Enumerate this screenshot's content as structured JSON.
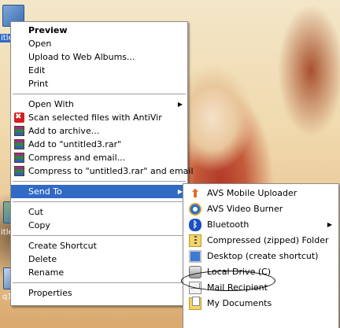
{
  "desktop": {
    "icons": [
      {
        "label": "itle"
      },
      {
        "label": "itle"
      },
      {
        "label": "q1"
      }
    ]
  },
  "context_menu": {
    "items": [
      {
        "label": "Preview",
        "bold": true
      },
      {
        "label": "Open"
      },
      {
        "label": "Upload to Web Albums..."
      },
      {
        "label": "Edit"
      },
      {
        "label": "Print"
      },
      {
        "label": "Open With",
        "submenu": true
      },
      {
        "label": "Scan selected files with AntiVir",
        "icon": "antivir-icon"
      },
      {
        "label": "Add to archive...",
        "icon": "winrar-icon"
      },
      {
        "label": "Add to \"untitled3.rar\"",
        "icon": "winrar-icon"
      },
      {
        "label": "Compress and email...",
        "icon": "winrar-icon"
      },
      {
        "label": "Compress to \"untitled3.rar\" and email",
        "icon": "winrar-icon"
      },
      {
        "label": "Send To",
        "submenu": true,
        "selected": true
      },
      {
        "label": "Cut"
      },
      {
        "label": "Copy"
      },
      {
        "label": "Create Shortcut"
      },
      {
        "label": "Delete"
      },
      {
        "label": "Rename"
      },
      {
        "label": "Properties"
      }
    ]
  },
  "send_to_menu": {
    "items": [
      {
        "label": "AVS Mobile Uploader",
        "icon": "upload-arrow-icon"
      },
      {
        "label": "AVS Video Burner",
        "icon": "video-burner-icon"
      },
      {
        "label": "Bluetooth",
        "icon": "bluetooth-icon",
        "submenu": true
      },
      {
        "label": "Compressed (zipped) Folder",
        "icon": "zip-folder-icon"
      },
      {
        "label": "Desktop (create shortcut)",
        "icon": "desktop-icon"
      },
      {
        "label": "Local Drive (C)",
        "icon": "drive-icon",
        "highlighted": true
      },
      {
        "label": "Mail Recipient",
        "icon": "mail-icon"
      },
      {
        "label": "My Documents",
        "icon": "my-documents-icon"
      }
    ]
  },
  "arrow_glyph": "▶"
}
